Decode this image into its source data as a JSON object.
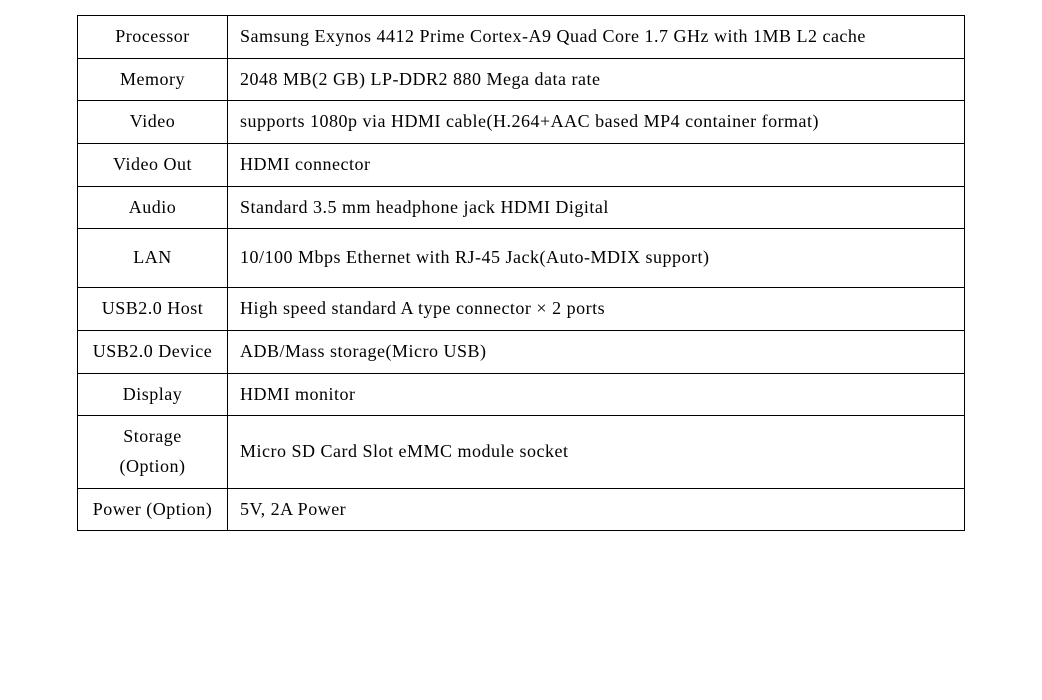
{
  "specs": {
    "processor": {
      "label": "Processor",
      "value": "Samsung Exynos 4412 Prime Cortex-A9 Quad Core 1.7 GHz with 1MB L2 cache"
    },
    "memory": {
      "label": "Memory",
      "value": "2048 MB(2 GB)  LP-DDR2 880 Mega data rate"
    },
    "video": {
      "label": "Video",
      "value": "supports 1080p via HDMI cable(H.264+AAC based MP4 container format)"
    },
    "videoOut": {
      "label_line1": "Video",
      "label_line2": "Out",
      "value": "HDMI connector"
    },
    "audio": {
      "label": "Audio",
      "value_line1": "Standard 3.5 mm headphone jack",
      "value_line2": "HDMI Digital"
    },
    "lan": {
      "label": "LAN",
      "value": "10/100 Mbps Ethernet with RJ-45 Jack(Auto-MDIX support)"
    },
    "usbHost": {
      "label_line1": "USB2.0",
      "label_line2": "Host",
      "value": "High speed standard A type connector × 2 ports"
    },
    "usbDevice": {
      "label_line1": "USB2.0",
      "label_line2": "Device",
      "value": "ADB/Mass storage(Micro USB)"
    },
    "display": {
      "label": "Display",
      "value": "HDMI monitor"
    },
    "storage": {
      "label_line1": "Storage",
      "label_line2": "(Option)",
      "value_line1": "Micro SD Card Slot",
      "value_line2": "eMMC module socket"
    },
    "power": {
      "label_line1": "Power",
      "label_line2": "(Option)",
      "value": "5V, 2A Power"
    }
  }
}
